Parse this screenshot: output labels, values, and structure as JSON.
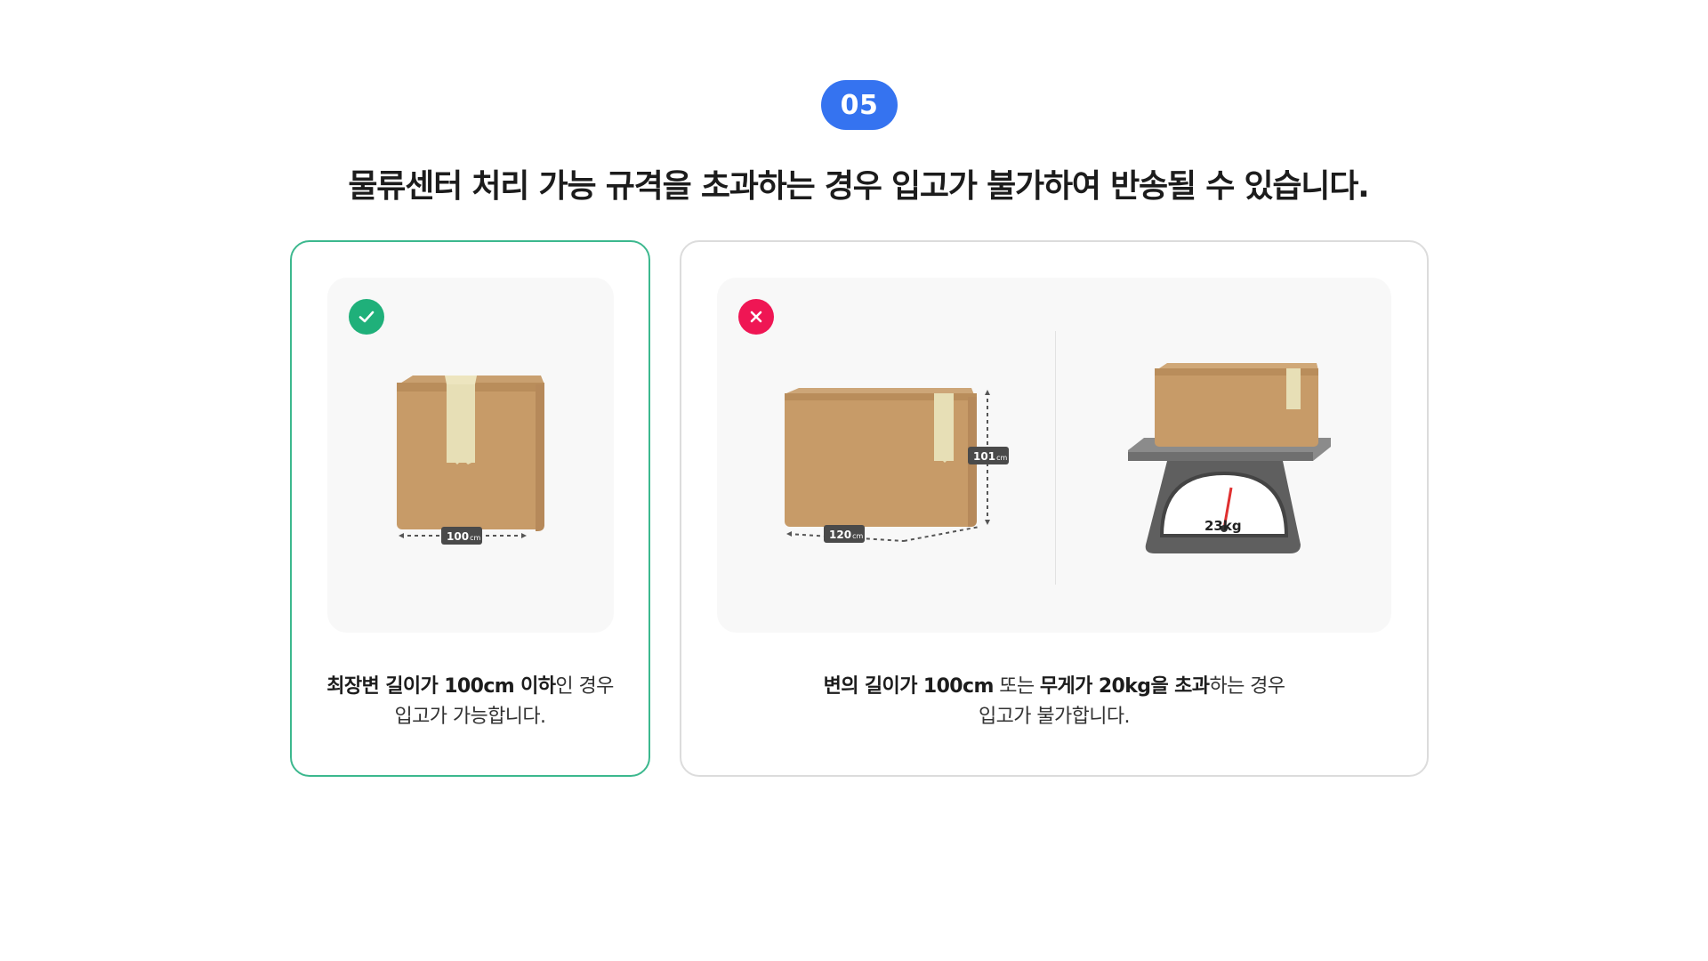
{
  "step": {
    "number": "05"
  },
  "headline": "물류센터 처리 가능 규격을 초과하는 경우 입고가 불가하여 반송될 수 있습니다.",
  "colors": {
    "accent": "#3573f0",
    "ok": "#1fb07a",
    "ok_border": "#3cb88e",
    "ng": "#ef1654"
  },
  "ok_card": {
    "icon": "check-icon",
    "dimension_label": {
      "value": "100",
      "unit": "cm"
    },
    "caption": {
      "line1_bold": "최장변 길이가 100cm 이하",
      "line1_rest": "인 경우",
      "line2": "입고가 가능합니다."
    }
  },
  "ng_card": {
    "icon": "close-icon",
    "width_label": {
      "value": "120",
      "unit": "cm"
    },
    "height_label": {
      "value": "101",
      "unit": "cm"
    },
    "scale_reading": "23kg",
    "caption": {
      "part1_bold": "변의 길이가 100cm",
      "part2": " 또는 ",
      "part3_bold": "무게가 20kg을 초과",
      "part4": "하는 경우",
      "line2": "입고가 불가합니다."
    }
  }
}
